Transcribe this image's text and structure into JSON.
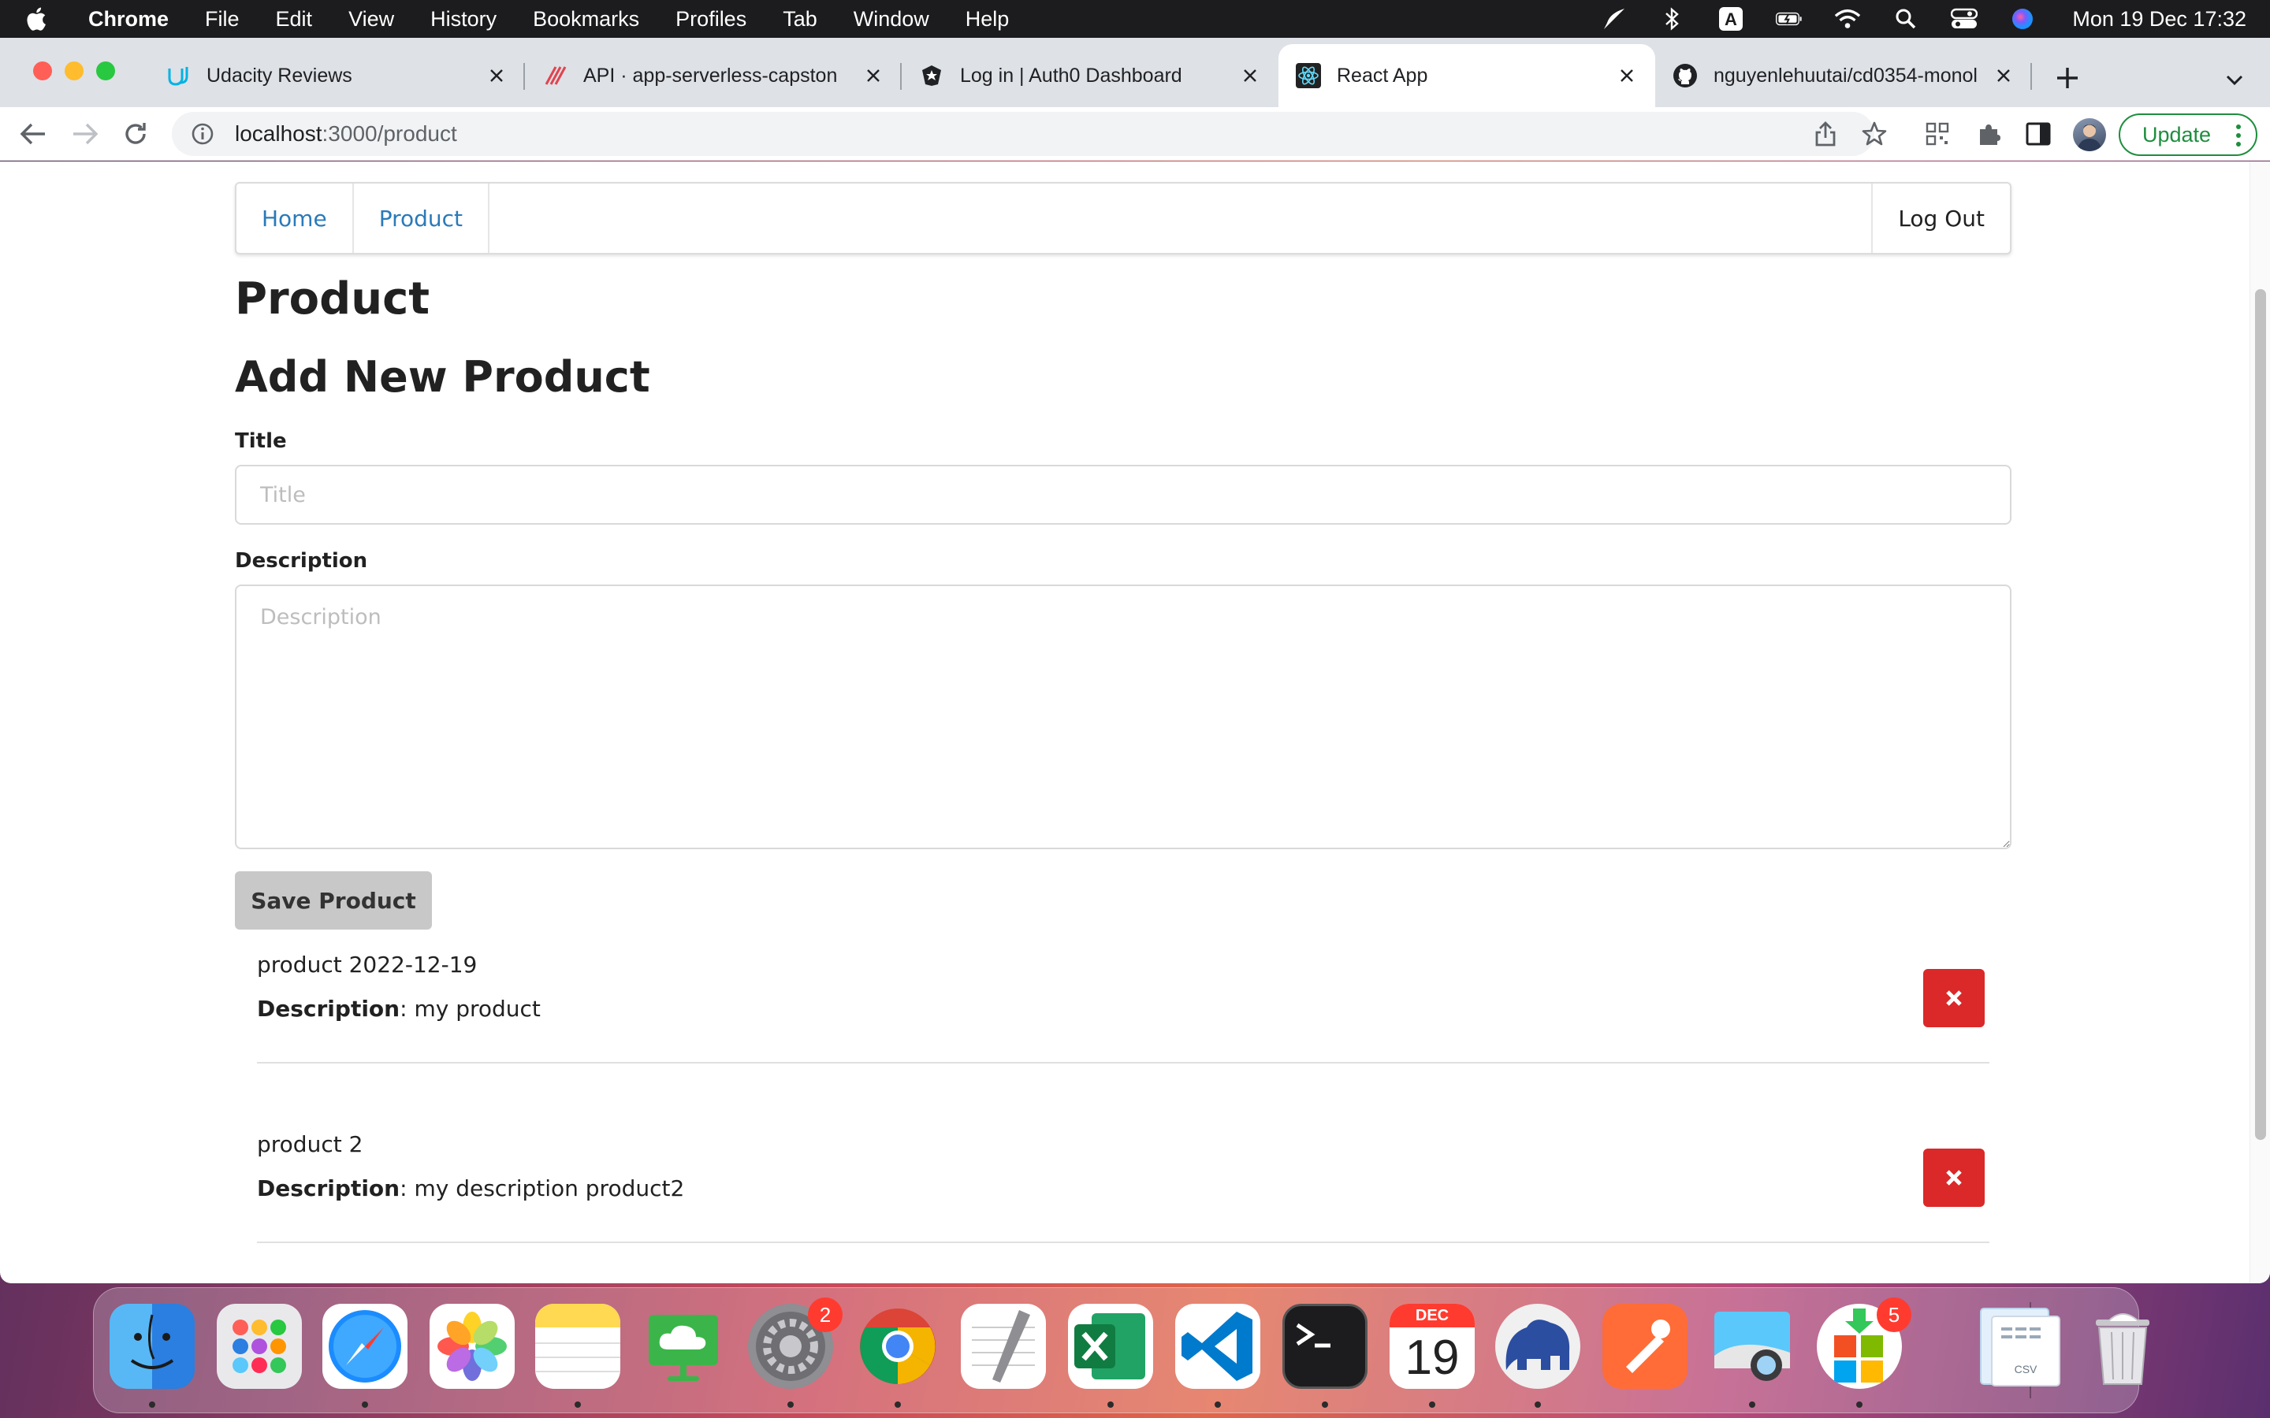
{
  "menubar": {
    "app_name": "Chrome",
    "menus": [
      "File",
      "Edit",
      "View",
      "History",
      "Bookmarks",
      "Profiles",
      "Tab",
      "Window",
      "Help"
    ],
    "clock": "Mon 19 Dec  17:32",
    "input_source": "A"
  },
  "browser": {
    "tabs": [
      {
        "title": "Udacity Reviews",
        "icon": "udacity-icon"
      },
      {
        "title": "API · app-serverless-capston",
        "icon": "api-gateway-icon"
      },
      {
        "title": "Log in | Auth0 Dashboard",
        "icon": "auth0-icon"
      },
      {
        "title": "React App",
        "icon": "react-icon"
      },
      {
        "title": "nguyenlehuutai/cd0354-monol",
        "icon": "github-icon"
      }
    ],
    "active_tab": 3,
    "url_host": "localhost",
    "url_path": ":3000/product",
    "update_label": "Update"
  },
  "page": {
    "nav": {
      "home": "Home",
      "product": "Product",
      "logout": "Log Out"
    },
    "title": "Product",
    "form_title": "Add New Product",
    "title_label": "Title",
    "title_placeholder": "Title",
    "title_value": "",
    "description_label": "Description",
    "description_placeholder": "Description",
    "save_label": "Save Product",
    "desc_prefix": "Description",
    "products": [
      {
        "name": "product 2022-12-19",
        "description": "my product"
      },
      {
        "name": "product 2",
        "description": "my description product2"
      }
    ]
  },
  "dock": {
    "apps": [
      "finder",
      "launchpad",
      "safari",
      "photos",
      "notes",
      "cloud-desktop",
      "system-preferences",
      "chrome",
      "textedit",
      "excel",
      "vscode",
      "terminal",
      "calendar",
      "tableplus",
      "postman",
      "preview",
      "app-store",
      "downloads",
      "trash"
    ],
    "badges": {
      "system-preferences": "2",
      "app-store": "5"
    },
    "calendar_month": "DEC",
    "calendar_day": "19",
    "downloads_label": "CSV"
  }
}
